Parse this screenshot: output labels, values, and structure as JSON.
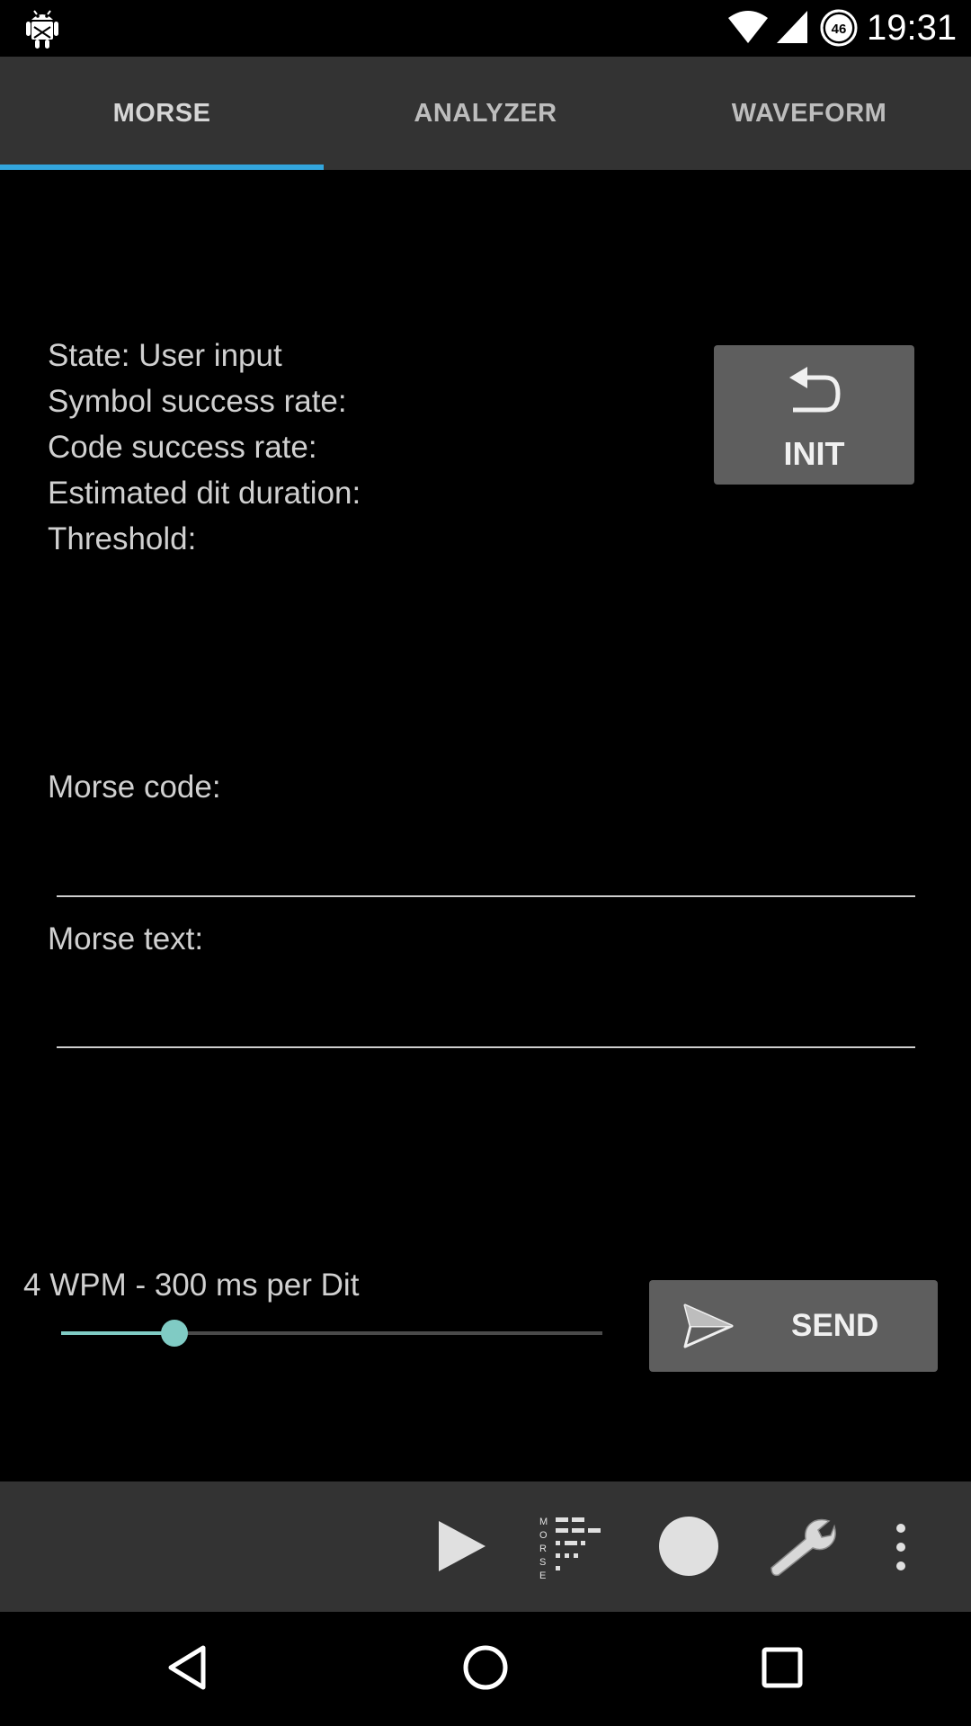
{
  "status_bar": {
    "time": "19:31",
    "battery_level": "46",
    "icons": [
      "android-debug-icon",
      "wifi-icon",
      "cell-signal-icon",
      "battery-icon"
    ]
  },
  "tabs": [
    {
      "label": "MORSE",
      "active": true
    },
    {
      "label": "ANALYZER",
      "active": false
    },
    {
      "label": "WAVEFORM",
      "active": false
    }
  ],
  "info": {
    "state": "State: User input",
    "symbol_success_rate": "Symbol success rate:",
    "code_success_rate": "Code success rate:",
    "estimated_dit_duration": "Estimated dit duration:",
    "threshold": "Threshold:"
  },
  "init_button": {
    "label": "INIT",
    "icon": "undo-icon"
  },
  "fields": {
    "morse_code": {
      "label": "Morse code:",
      "value": ""
    },
    "morse_text": {
      "label": "Morse text:",
      "value": ""
    }
  },
  "speed": {
    "label": "4 WPM - 300 ms per Dit",
    "slider_fraction": 0.21
  },
  "send_button": {
    "label": "SEND",
    "icon": "send-icon"
  },
  "toolbar": {
    "items": [
      "play-icon",
      "morse-icon",
      "record-icon",
      "settings-wrench-icon",
      "overflow-menu-icon"
    ],
    "morse_logo_letters": "MORSE"
  },
  "navbar": {
    "items": [
      "back-icon",
      "home-icon",
      "recents-icon"
    ]
  },
  "colors": {
    "accent": "#33a6de",
    "slider": "#80cbc4",
    "toolbar_bg": "#333333",
    "button_bg": "#5e5e5e"
  }
}
